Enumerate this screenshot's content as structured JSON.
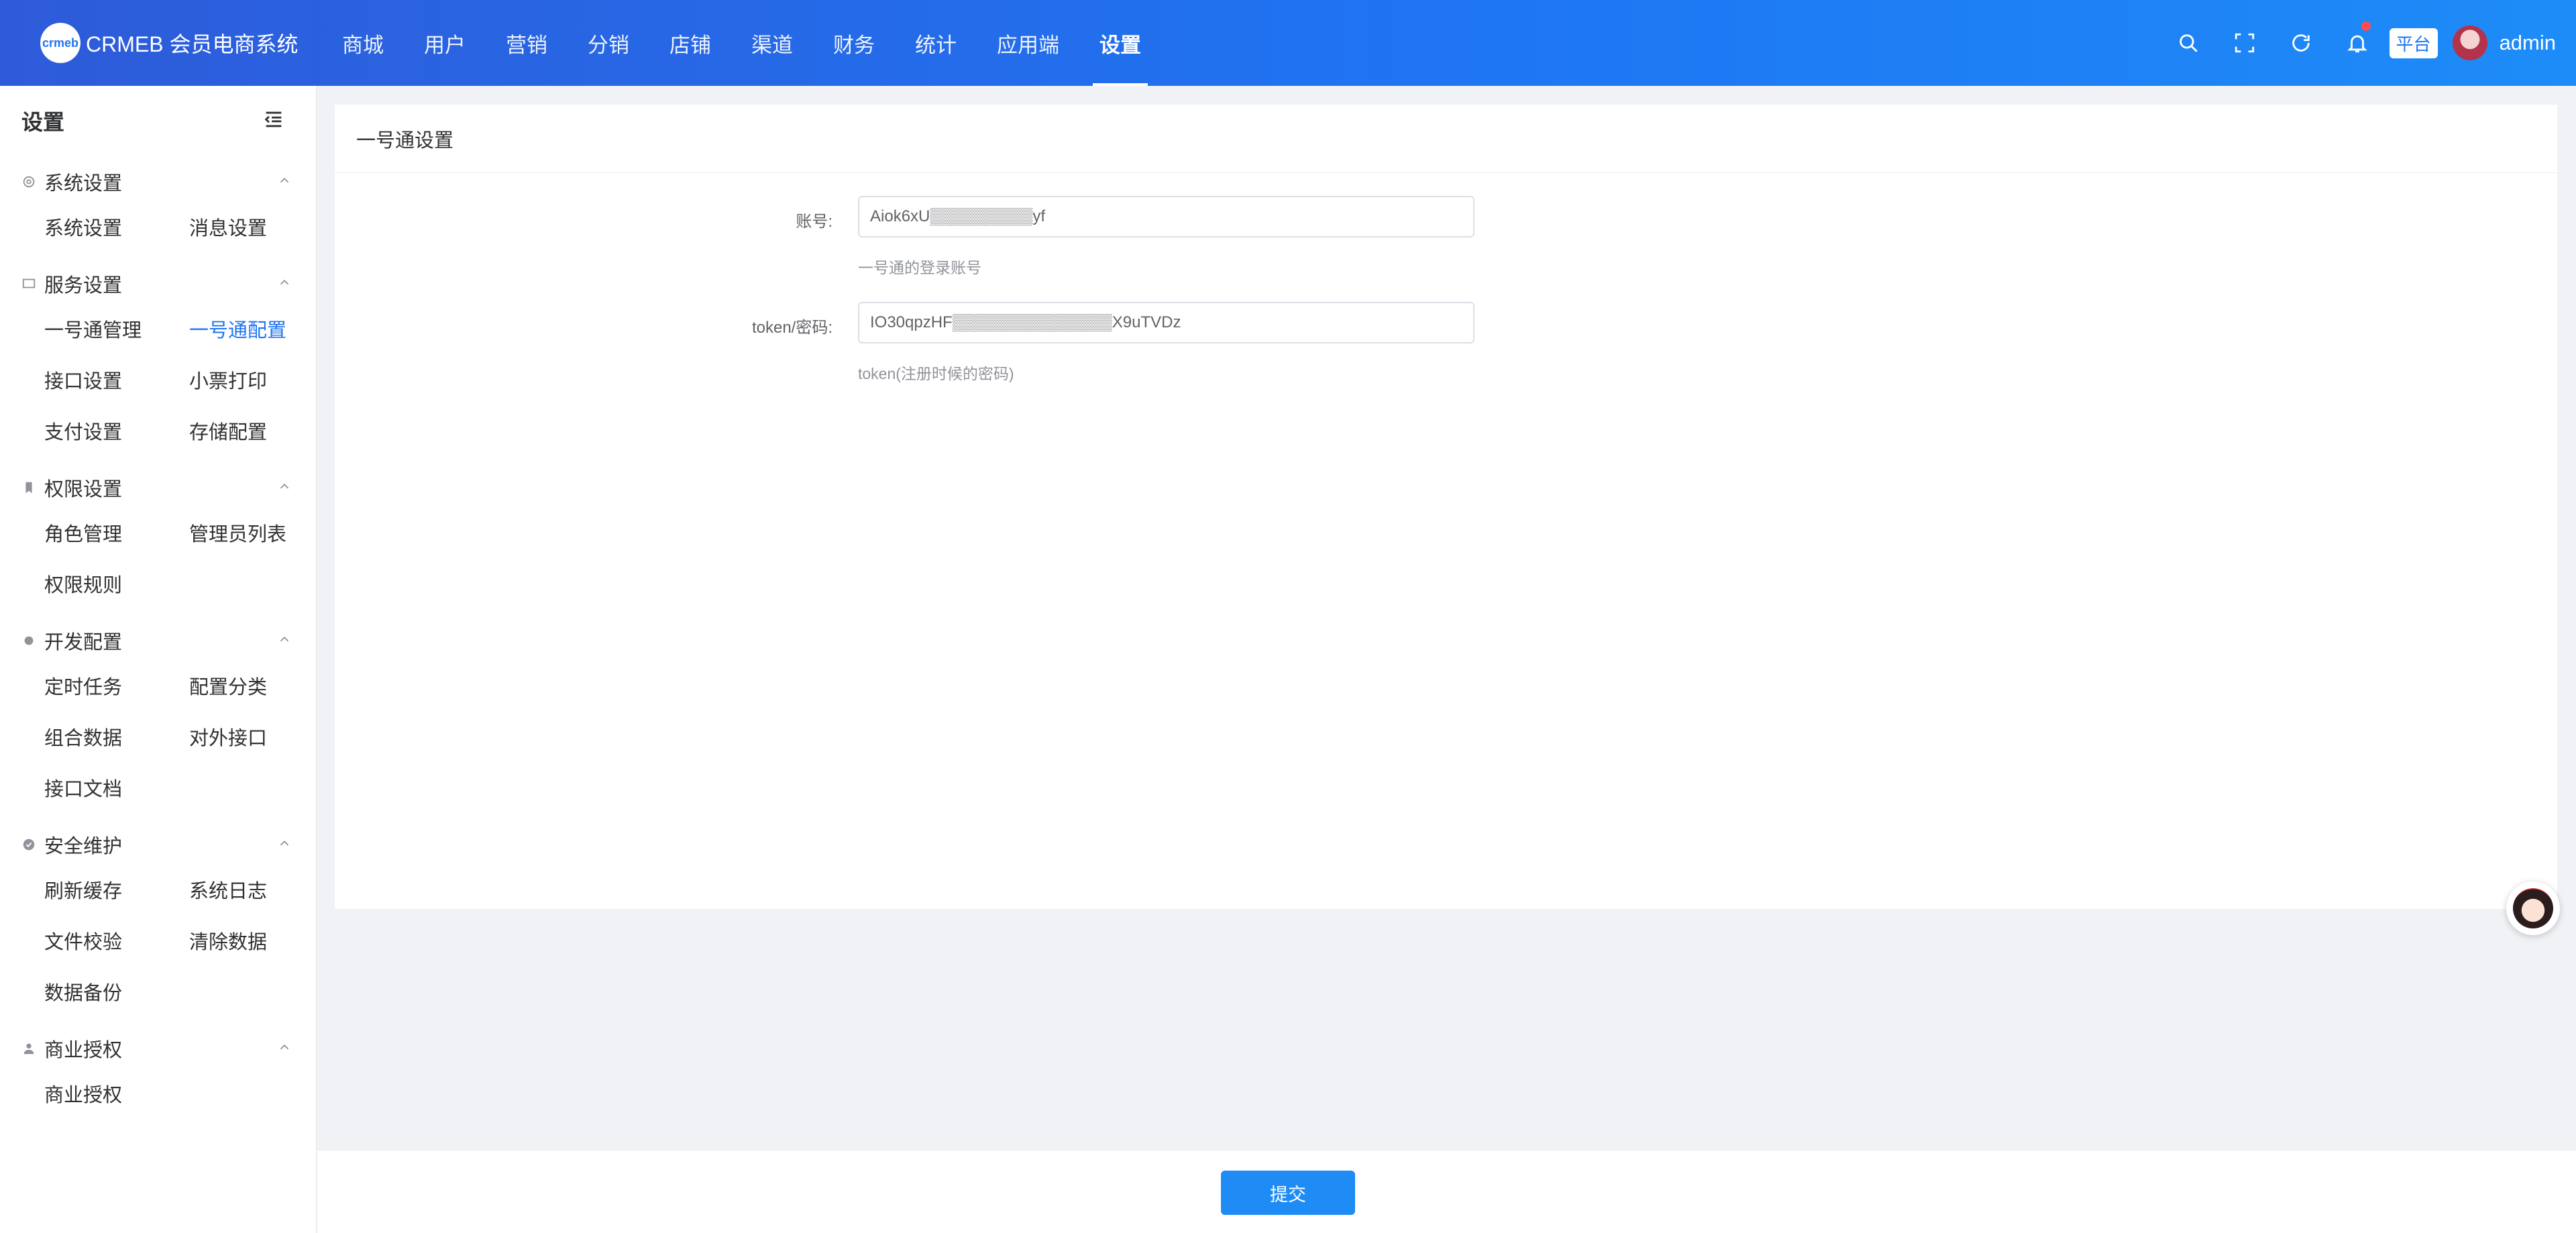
{
  "header": {
    "logo_mark": "crmeb",
    "brand": "CRMEB 会员电商系统",
    "nav": [
      "商城",
      "用户",
      "营销",
      "分销",
      "店铺",
      "渠道",
      "财务",
      "统计",
      "应用端",
      "设置"
    ],
    "active_nav": "设置",
    "icons": [
      "search-icon",
      "fullscreen-icon",
      "refresh-icon",
      "bell-icon"
    ],
    "platform_tag": "平台",
    "username": "admin",
    "notification_dot_color": "#ff4d4f"
  },
  "sidebar": {
    "title": "设置",
    "groups": [
      {
        "label": "系统设置",
        "icon": "gear-icon",
        "items": [
          "系统设置",
          "消息设置"
        ]
      },
      {
        "label": "服务设置",
        "icon": "monitor-icon",
        "items": [
          "一号通管理",
          "一号通配置",
          "接口设置",
          "小票打印",
          "支付设置",
          "存储配置"
        ]
      },
      {
        "label": "权限设置",
        "icon": "bookmark-icon",
        "items": [
          "角色管理",
          "管理员列表",
          "权限规则"
        ]
      },
      {
        "label": "开发配置",
        "icon": "cog-icon",
        "items": [
          "定时任务",
          "配置分类",
          "组合数据",
          "对外接口",
          "接口文档"
        ]
      },
      {
        "label": "安全维护",
        "icon": "check-circle-icon",
        "items": [
          "刷新缓存",
          "系统日志",
          "文件校验",
          "清除数据",
          "数据备份"
        ]
      },
      {
        "label": "商业授权",
        "icon": "user-icon",
        "items": [
          "商业授权"
        ]
      }
    ],
    "active_item": "一号通配置"
  },
  "form": {
    "title": "一号通设置",
    "account_label": "账号:",
    "account_value": "Aiok6xU▒▒▒▒▒▒▒▒▒yf",
    "account_hint": "一号通的登录账号",
    "token_label": "token/密码:",
    "token_value": "IO30qpzHF▒▒▒▒▒▒▒▒▒▒▒▒▒▒X9uTVDz",
    "token_hint": "token(注册时候的密码)",
    "submit_label": "提交"
  },
  "accent_color": "#1f74f2"
}
